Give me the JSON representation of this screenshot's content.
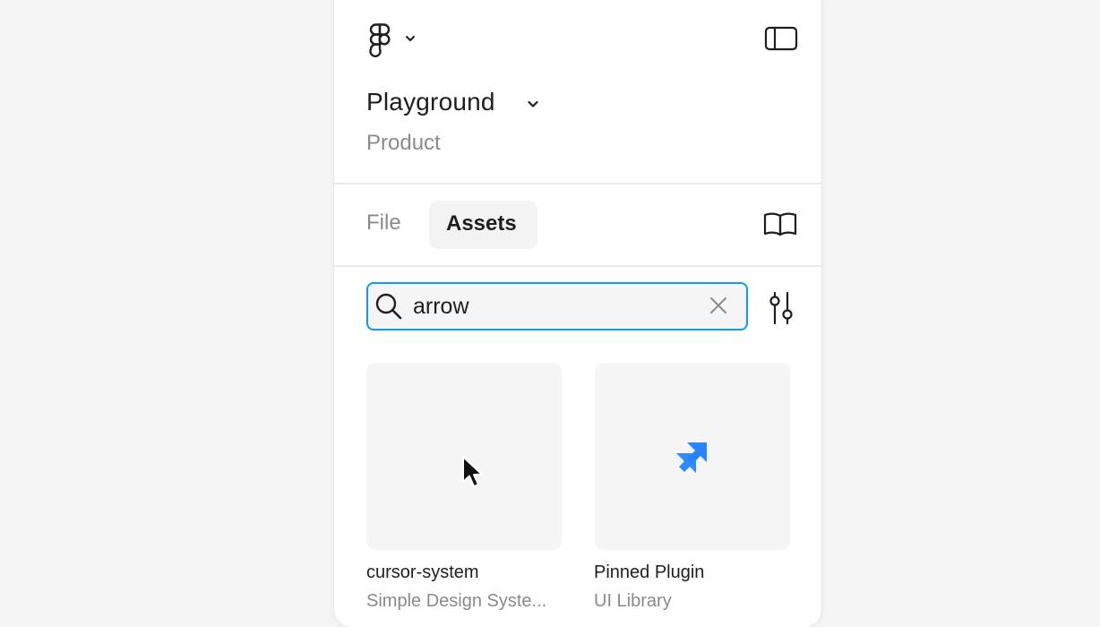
{
  "header": {
    "project_title": "Playground",
    "team_name": "Product"
  },
  "tabs": [
    {
      "label": "File",
      "active": false
    },
    {
      "label": "Assets",
      "active": true
    }
  ],
  "search": {
    "value": "arrow",
    "placeholder": ""
  },
  "results": [
    {
      "title": "cursor-system",
      "subtitle": "Simple Design Syste...",
      "thumbnail_icon": "cursor-arrow-icon"
    },
    {
      "title": "Pinned Plugin",
      "subtitle": "UI Library",
      "thumbnail_icon": "double-chevron-icon"
    }
  ],
  "colors": {
    "accent": "#0d99ff",
    "plugin_icon": "#2684ff"
  }
}
